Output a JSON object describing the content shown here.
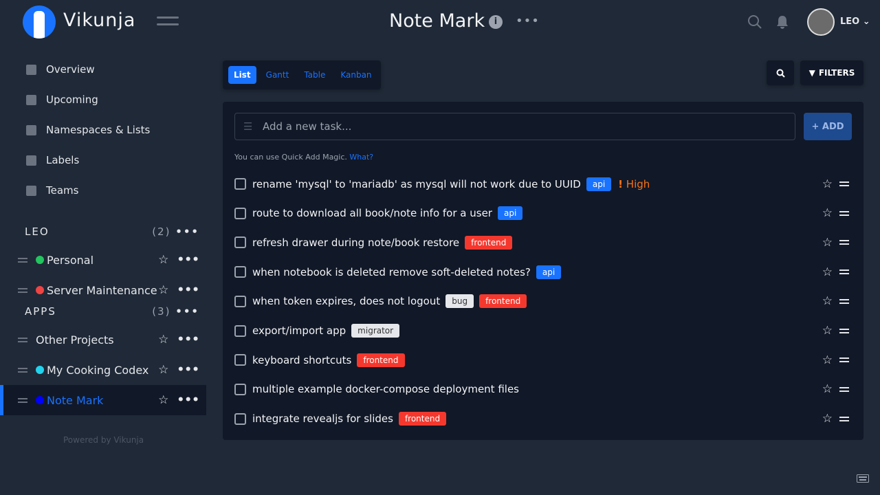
{
  "header": {
    "brand": "Vikunja",
    "title": "Note Mark",
    "user": "LEO"
  },
  "nav": [
    {
      "label": "Overview"
    },
    {
      "label": "Upcoming"
    },
    {
      "label": "Namespaces & Lists"
    },
    {
      "label": "Labels"
    },
    {
      "label": "Teams"
    }
  ],
  "namespaces": [
    {
      "name": "LEO",
      "count": "(2)",
      "projects": [
        {
          "name": "Personal",
          "color": "#22c55e"
        },
        {
          "name": "Server Maintenance",
          "color": "#ef4444"
        }
      ]
    },
    {
      "name": "APPS",
      "count": "(3)",
      "projects": [
        {
          "name": "Other Projects",
          "color": ""
        },
        {
          "name": "My Cooking Codex",
          "color": "#22d3ee"
        },
        {
          "name": "Note Mark",
          "color": "#0000ff",
          "active": true
        }
      ]
    }
  ],
  "powered": "Powered by Vikunja",
  "views": [
    "List",
    "Gantt",
    "Table",
    "Kanban"
  ],
  "filters_label": "FILTERS",
  "add_task": {
    "placeholder": "Add a new task...",
    "button": "+ ADD",
    "hint": "You can use Quick Add Magic.",
    "hint_link": "What?"
  },
  "tasks": [
    {
      "title": "rename 'mysql' to 'mariadb' as mysql will not work due to UUID",
      "labels": [
        {
          "t": "api",
          "bg": "#1973ff",
          "fg": "#fff"
        }
      ],
      "priority": "High"
    },
    {
      "title": "route to download all book/note info for a user",
      "labels": [
        {
          "t": "api",
          "bg": "#1973ff",
          "fg": "#fff"
        }
      ]
    },
    {
      "title": "refresh drawer during note/book restore",
      "labels": [
        {
          "t": "frontend",
          "bg": "#f5382e",
          "fg": "#fff"
        }
      ]
    },
    {
      "title": "when notebook is deleted remove soft-deleted notes?",
      "labels": [
        {
          "t": "api",
          "bg": "#1973ff",
          "fg": "#fff"
        }
      ]
    },
    {
      "title": "when token expires, does not logout",
      "labels": [
        {
          "t": "bug",
          "bg": "#e5e7eb",
          "fg": "#333"
        },
        {
          "t": "frontend",
          "bg": "#f5382e",
          "fg": "#fff"
        }
      ]
    },
    {
      "title": "export/import app",
      "labels": [
        {
          "t": "migrator",
          "bg": "#e5e7eb",
          "fg": "#333"
        }
      ]
    },
    {
      "title": "keyboard shortcuts",
      "labels": [
        {
          "t": "frontend",
          "bg": "#f5382e",
          "fg": "#fff"
        }
      ]
    },
    {
      "title": "multiple example docker-compose deployment files",
      "labels": []
    },
    {
      "title": "integrate revealjs for slides",
      "labels": [
        {
          "t": "frontend",
          "bg": "#f5382e",
          "fg": "#fff"
        }
      ]
    }
  ]
}
